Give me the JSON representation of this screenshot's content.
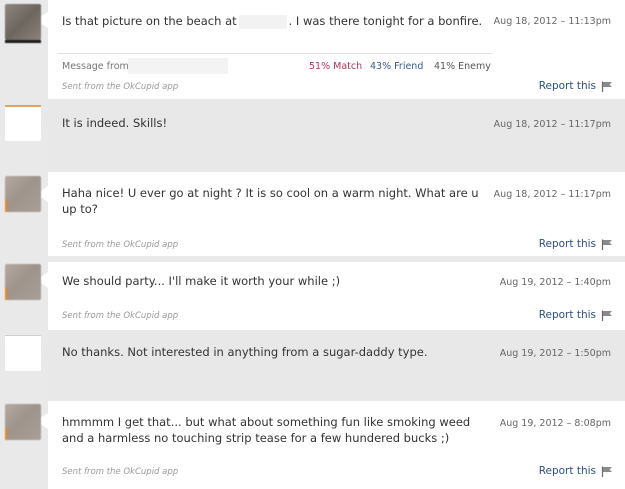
{
  "messages": [
    {
      "id": 1,
      "text_before": "Is that picture on the beach at",
      "text_after": ". I was there tonight for a bonfire.",
      "time": "Aug 18, 2012 – 11:13pm",
      "message_from_label": "Message from",
      "match": "51% Match",
      "friend": "43% Friend",
      "enemy": "41% Enemy",
      "sent_from": "Sent from the OkCupid app",
      "report": "Report this"
    },
    {
      "id": 2,
      "text": "It is indeed. Skills!",
      "time": "Aug 18, 2012 – 11:17pm"
    },
    {
      "id": 3,
      "text": "Haha nice! U ever go at night ? It is so cool on a warm night. What are u up to?",
      "time": "Aug 18, 2012 – 11:17pm",
      "sent_from": "Sent from the OkCupid app",
      "report": "Report this"
    },
    {
      "id": 4,
      "text": "We should party... I'll make it worth your while ;)",
      "time": "Aug 19, 2012 – 1:40pm",
      "sent_from": "Sent from the OkCupid app",
      "report": "Report this"
    },
    {
      "id": 5,
      "text": "No thanks. Not interested in anything from a sugar-daddy type.",
      "time": "Aug 19, 2012 – 1:50pm"
    },
    {
      "id": 6,
      "text": "hmmmm I get that... but what about something fun like smoking weed and a harmless no touching strip tease for a few hundered bucks ;)",
      "time": "Aug 19, 2012 – 8:08pm",
      "sent_from": "Sent from the OkCupid app",
      "report": "Report this"
    }
  ],
  "colors": {
    "page_background": "#e9e9e9",
    "incoming_bubble": "#ffffff",
    "outgoing_bubble": "#e8e8e8",
    "match": "#b2365a",
    "friend": "#3a5a8e",
    "link": "#2d4f7f"
  },
  "icons": {
    "report": "flag-icon"
  }
}
